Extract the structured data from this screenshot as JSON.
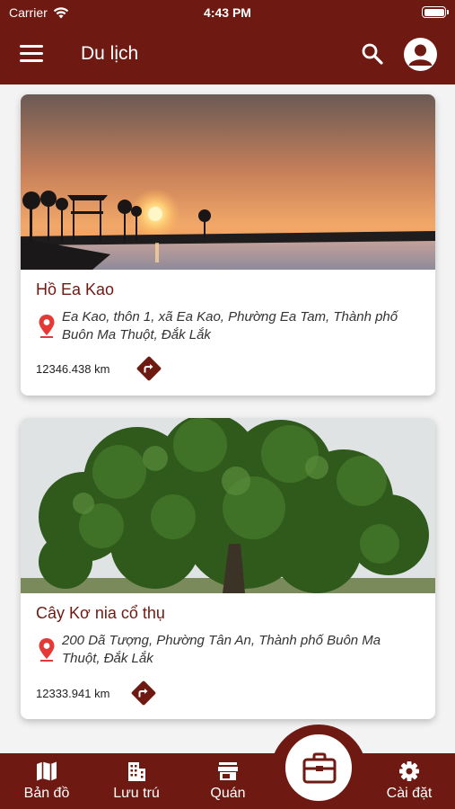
{
  "status_bar": {
    "carrier": "Carrier",
    "time": "4:43 PM"
  },
  "header": {
    "title": "Du lịch",
    "menu_icon": "menu-icon",
    "search_icon": "search-icon",
    "profile_icon": "account-icon"
  },
  "places": [
    {
      "name": "Hồ Ea Kao",
      "address": "Ea Kao, thôn 1, xã Ea Kao,  Phường Ea Tam, Thành phố Buôn Ma Thuột, Đắk Lắk",
      "distance": "12346.438 km"
    },
    {
      "name": "Cây Kơ nia cổ thụ",
      "address": "200 Dã Tượng, Phường Tân An, Thành phố Buôn Ma Thuột, Đắk Lắk",
      "distance": "12333.941 km"
    }
  ],
  "tabs": [
    {
      "label": "Bản đồ",
      "icon": "map-icon"
    },
    {
      "label": "Lưu trú",
      "icon": "building-icon"
    },
    {
      "label": "Quán",
      "icon": "store-icon"
    },
    {
      "label": "Cài đặt",
      "icon": "gear-icon"
    }
  ],
  "fab_icon": "briefcase-icon",
  "colors": {
    "primary": "#6e1a12",
    "pin": "#e53935",
    "background": "#f3f3f3"
  }
}
